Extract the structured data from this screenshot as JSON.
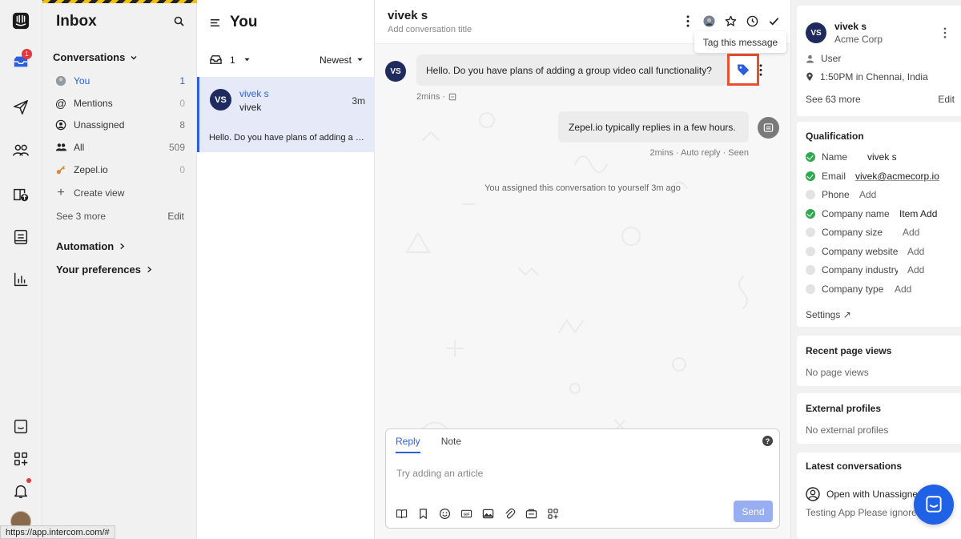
{
  "rail": {
    "inbox_badge": "1"
  },
  "nav": {
    "title": "Inbox",
    "section_label": "Conversations",
    "items": [
      {
        "label": "You",
        "count": "1"
      },
      {
        "label": "Mentions",
        "count": "0"
      },
      {
        "label": "Unassigned",
        "count": "8"
      },
      {
        "label": "All",
        "count": "509"
      },
      {
        "label": "Zepel.io",
        "count": "0"
      }
    ],
    "create_view": "Create view",
    "see_more": "See 3 more",
    "edit": "Edit",
    "automation": "Automation",
    "preferences": "Your preferences"
  },
  "list": {
    "title": "You",
    "open_count": "1",
    "sort_label": "Newest",
    "conversation": {
      "avatar": "VS",
      "name": "vivek s",
      "subtitle": "vivek",
      "time": "3m",
      "preview": "Hello. Do you have plans of adding a group video call functionality?"
    }
  },
  "main": {
    "name": "vivek s",
    "title_placeholder": "Add conversation title",
    "tooltip": "Tag this message",
    "incoming": {
      "avatar": "VS",
      "text": "Hello. Do you have plans of adding a group video call functionality?",
      "meta": "2mins ·"
    },
    "outgoing": {
      "text": "Zepel.io typically replies in a few hours.",
      "meta": "2mins · Auto reply · Seen"
    },
    "event": "You assigned this conversation to yourself 3m ago",
    "composer": {
      "tab_reply": "Reply",
      "tab_note": "Note",
      "placeholder": "Try adding an article",
      "send": "Send"
    }
  },
  "sidebar": {
    "user": {
      "avatar": "VS",
      "name": "vivek s",
      "company": "Acme Corp",
      "role": "User",
      "location": "1:50PM in Chennai, India",
      "see_more": "See 63 more",
      "edit": "Edit"
    },
    "qualification": {
      "title": "Qualification",
      "rows": [
        {
          "label": "Name",
          "value": "vivek s",
          "done": true
        },
        {
          "label": "Email",
          "value": "vivek@acmecorp.io",
          "done": true
        },
        {
          "label": "Phone",
          "value": "Add",
          "done": false
        },
        {
          "label": "Company name",
          "value": "Item Add",
          "done": true
        },
        {
          "label": "Company size",
          "value": "Add",
          "done": false
        },
        {
          "label": "Company website",
          "value": "Add",
          "done": false
        },
        {
          "label": "Company industry",
          "value": "Add",
          "done": false
        },
        {
          "label": "Company type",
          "value": "Add",
          "done": false
        }
      ],
      "settings": "Settings ↗"
    },
    "page_views": {
      "title": "Recent page views",
      "empty": "No page views"
    },
    "external": {
      "title": "External profiles",
      "empty": "No external profiles"
    },
    "latest": {
      "title": "Latest conversations",
      "row_label": "Open with Unassigned",
      "row_sub": "Testing App Please ignore"
    }
  },
  "status_url": "https://app.intercom.com/#",
  "colors": {
    "accent": "#2c5fde",
    "highlight": "#e8502f",
    "messenger": "#1f62e5",
    "success": "#2fa84f"
  }
}
